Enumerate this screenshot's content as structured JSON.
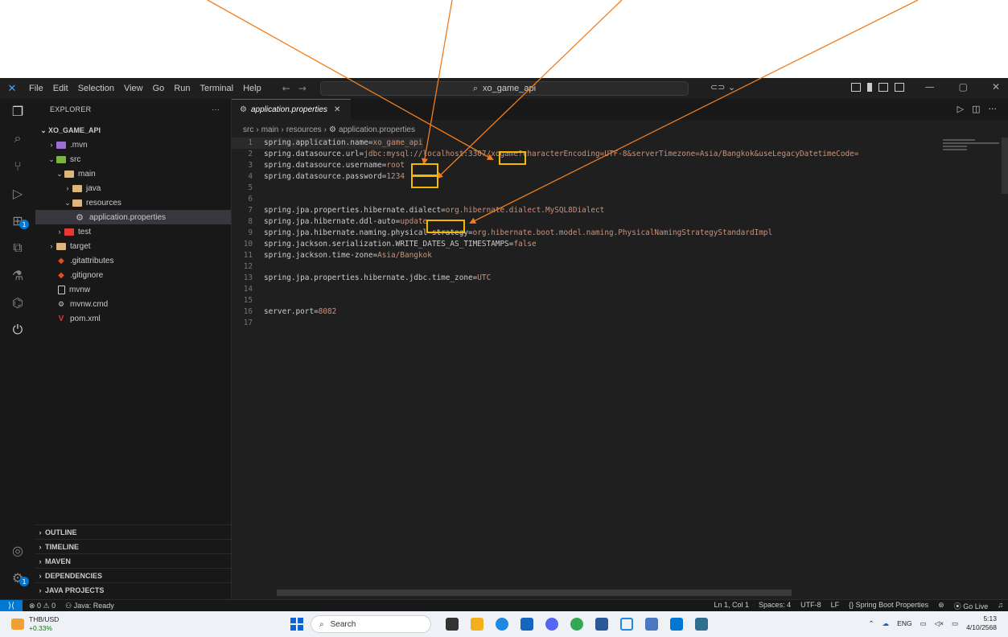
{
  "titlebar": {
    "menu": [
      "File",
      "Edit",
      "Selection",
      "View",
      "Go",
      "Run",
      "Terminal",
      "Help"
    ],
    "search": "xo_game_api"
  },
  "explorer": {
    "title": "EXPLORER",
    "more": "···",
    "root": "XO_GAME_API",
    "items": [
      {
        "label": ".mvn"
      },
      {
        "label": "src"
      },
      {
        "label": "main"
      },
      {
        "label": "java"
      },
      {
        "label": "resources"
      },
      {
        "label": "application.properties"
      },
      {
        "label": "test"
      },
      {
        "label": "target"
      },
      {
        "label": ".gitattributes"
      },
      {
        "label": ".gitignore"
      },
      {
        "label": "mvnw"
      },
      {
        "label": "mvnw.cmd"
      },
      {
        "label": "pom.xml"
      }
    ],
    "sections": [
      "OUTLINE",
      "TIMELINE",
      "MAVEN",
      "DEPENDENCIES",
      "JAVA PROJECTS"
    ]
  },
  "editor": {
    "tab_label": "application.properties",
    "breadcrumb": [
      "src",
      "main",
      "resources",
      "application.properties"
    ],
    "lines": [
      {
        "n": "1",
        "key": "spring.application.name=",
        "val": "xo_game_api"
      },
      {
        "n": "2",
        "key": "spring.datasource.url=",
        "val": "jdbc:mysql://localhost:3307/xogame?characterEncoding=UTF-8&serverTimezone=Asia/Bangkok&useLegacyDatetimeCode="
      },
      {
        "n": "3",
        "key": "spring.datasource.username=",
        "val": "root"
      },
      {
        "n": "4",
        "key": "spring.datasource.password=",
        "val": "1234"
      },
      {
        "n": "5",
        "key": "",
        "val": ""
      },
      {
        "n": "6",
        "key": "",
        "val": ""
      },
      {
        "n": "7",
        "key": "spring.jpa.properties.hibernate.dialect=",
        "val": "org.hibernate.dialect.MySQL8Dialect"
      },
      {
        "n": "8",
        "key": "spring.jpa.hibernate.ddl-auto=",
        "val": "update"
      },
      {
        "n": "9",
        "key": "spring.jpa.hibernate.naming.physical-strategy=",
        "val": "org.hibernate.boot.model.naming.PhysicalNamingStrategyStandardImpl"
      },
      {
        "n": "10",
        "key": "spring.jackson.serialization.WRITE_DATES_AS_TIMESTAMPS=",
        "val": "false"
      },
      {
        "n": "11",
        "key": "spring.jackson.time-zone=",
        "val": "Asia/Bangkok"
      },
      {
        "n": "12",
        "key": "",
        "val": ""
      },
      {
        "n": "13",
        "key": "spring.jpa.properties.hibernate.jdbc.time_zone=",
        "val": "UTC"
      },
      {
        "n": "14",
        "key": "",
        "val": ""
      },
      {
        "n": "15",
        "key": "",
        "val": ""
      },
      {
        "n": "16",
        "key": "server.port=",
        "val": "8082"
      },
      {
        "n": "17",
        "key": "",
        "val": ""
      }
    ]
  },
  "statusbar": {
    "problems": "⊗ 0 ⚠ 0",
    "java": "Java: Ready",
    "position": "Ln 1, Col 1",
    "spaces": "Spaces: 4",
    "encoding": "UTF-8",
    "eol": "LF",
    "language": "{} Spring Boot Properties",
    "golive": "Go Live"
  },
  "taskbar": {
    "ticker": "THB/USD",
    "change": "+0.33%",
    "search": "Search",
    "lang": "ENG",
    "time": "5:13",
    "date": "4/10/2568"
  },
  "colors": {
    "accent": "#0078d4",
    "annotation_arrow": "#f07d1e",
    "annotation_box": "#f5b800"
  }
}
